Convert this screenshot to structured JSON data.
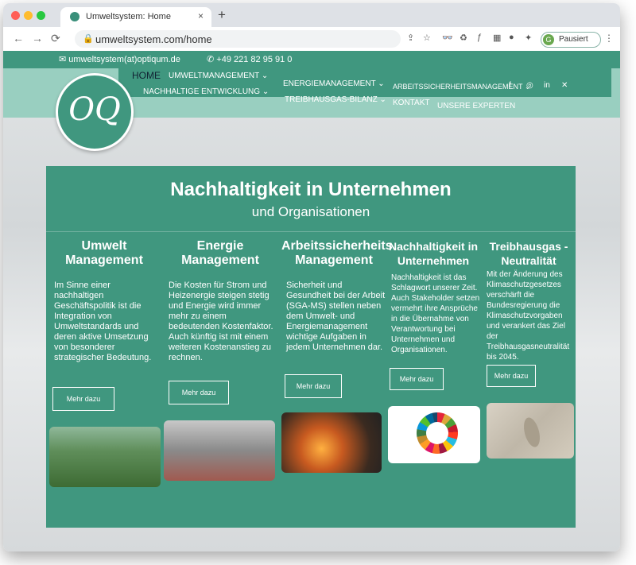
{
  "browser": {
    "tab_title": "Umweltsystem: Home",
    "url": "umweltsystem.com/home",
    "profile_initial": "G",
    "profile_label": "Pausiert",
    "back_icon": "←",
    "forward_icon": "→",
    "reload_icon": "⟳",
    "lock_icon": "🔒",
    "new_tab_icon": "+",
    "close_tab_icon": "×",
    "menu_icon": "⋮"
  },
  "contact": {
    "email": "umweltsystem(at)optiqum.de",
    "phone": "+49 221 82 95 91 0",
    "email_icon": "✉",
    "phone_icon": "✆"
  },
  "logo": {
    "text": "OQ"
  },
  "nav": {
    "home": "Home",
    "umweltmanagement": "Umweltmanagement ⌄",
    "energiemanagement": "Energiemanagement ⌄",
    "arbeitssicherheit": "Arbeitssicherheitsmanagement ⌄",
    "nachhaltige": "Nachhaltige Entwicklung ⌄",
    "treibhausgas": "Treibhausgas-Bilanz ⌄",
    "kontakt": "Kontakt",
    "experten": "Unsere Experten"
  },
  "social": [
    "f",
    "◎",
    "in",
    "✕"
  ],
  "hero": {
    "title": "Nachhaltigkeit in Unternehmen",
    "subtitle": "und Organisationen"
  },
  "columns": [
    {
      "title": "Umwelt Management",
      "text": "Im Sinne einer nachhaltigen Geschäftspolitik ist die Integration von Umweltstandards und deren aktive Umsetzung von besonderer strategischer Bedeutung.",
      "button": "Mehr dazu"
    },
    {
      "title": "Energie Management",
      "text": "Die Kosten für Strom und Heizenergie steigen stetig und Energie wird immer mehr zu einem bedeutenden Kostenfaktor. Auch künftig ist mit einem weiteren Kostenanstieg zu rechnen.",
      "button": "Mehr dazu"
    },
    {
      "title": "Arbeitssicherheits Management",
      "text": "Sicherheit und Gesundheit bei der Arbeit (SGA-MS) stellen neben dem Umwelt- und Energiemanagement wichtige Aufgaben in jedem Unternehmen dar.",
      "button": "Mehr dazu"
    },
    {
      "title": "Nachhaltigkeit in Unternehmen",
      "text": "Nachhaltigkeit ist das Schlagwort unserer Zeit. Auch Stakeholder setzen vermehrt ihre Ansprüche in die Übernahme von Verantwortung bei Unternehmen und Organisationen.",
      "button": "Mehr dazu"
    },
    {
      "title": "Treibhausgas - Neutralität",
      "text": "Mit der Änderung des Klimaschutzgesetzes verschärft die Bundesregierung die Klimaschutzvorgaben und verankert das Ziel der Treibhausgasneutralität bis 2045.",
      "button": "Mehr dazu"
    }
  ],
  "colors": {
    "accent": "#40977f",
    "light_band": "#99cfc0"
  }
}
